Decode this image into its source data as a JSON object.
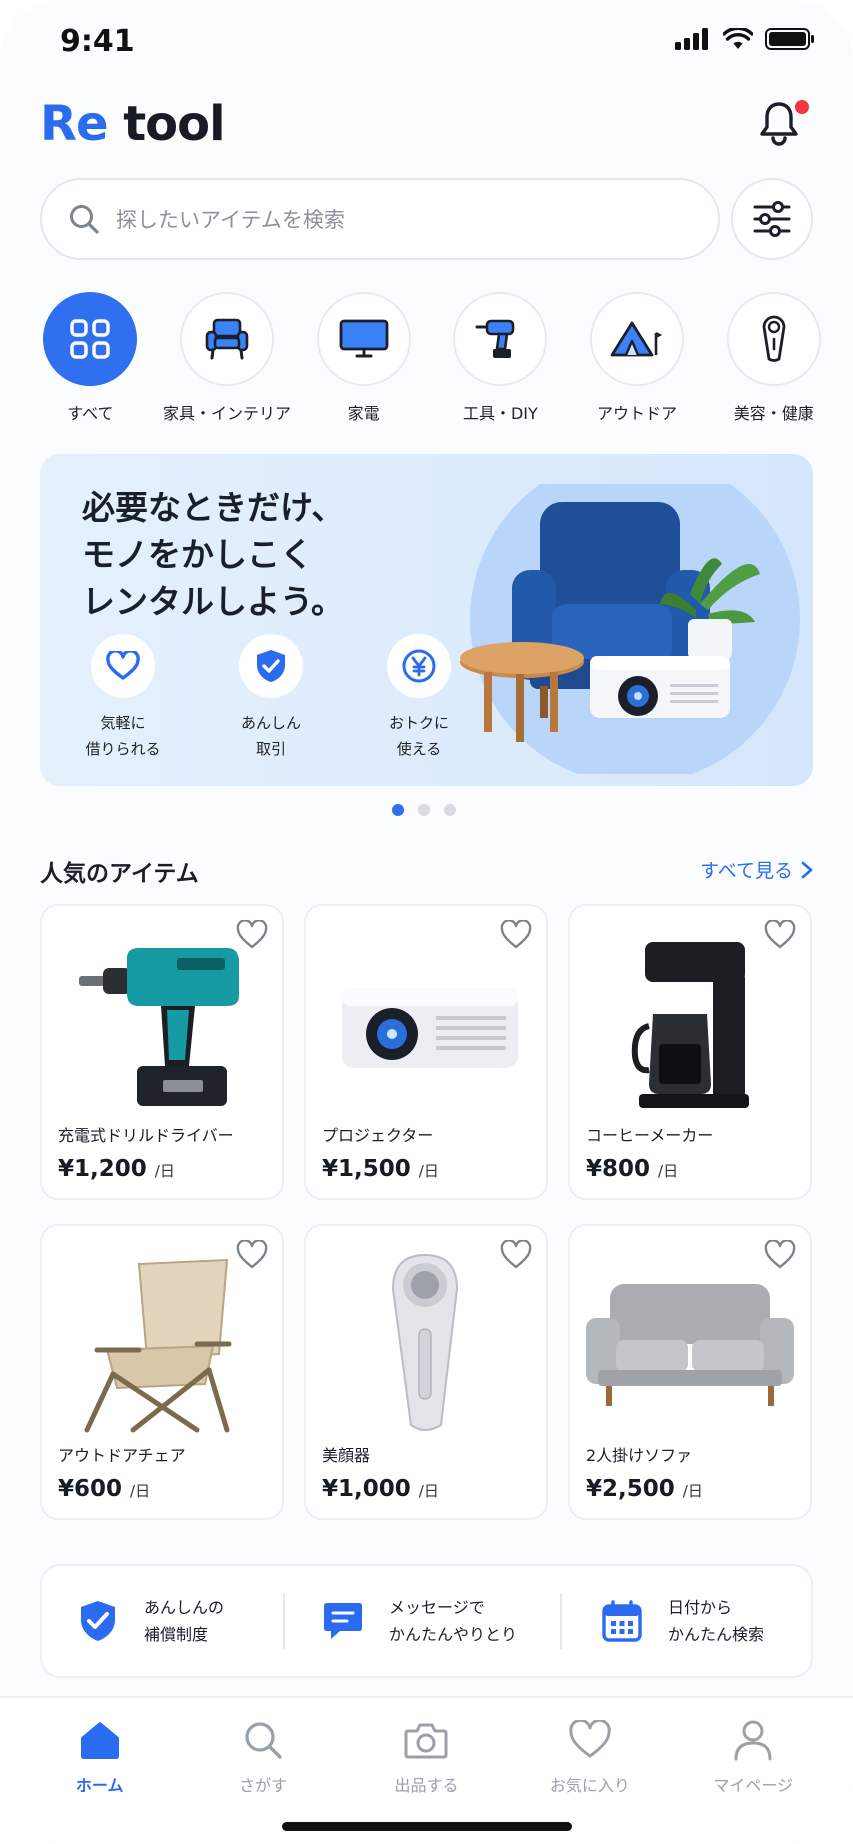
{
  "status_bar": {
    "time": "9:41"
  },
  "header": {
    "logo_re": "Re",
    "logo_tool": "tool"
  },
  "search": {
    "placeholder": "探したいアイテムを検索"
  },
  "categories": [
    {
      "label": "すべて",
      "icon": "grid-icon"
    },
    {
      "label": "家具・インテリア",
      "icon": "armchair-icon"
    },
    {
      "label": "家電",
      "icon": "monitor-icon"
    },
    {
      "label": "工具・DIY",
      "icon": "drill-icon"
    },
    {
      "label": "アウトドア",
      "icon": "tent-icon"
    },
    {
      "label": "美容・健康",
      "icon": "beauty-device-icon"
    }
  ],
  "banner": {
    "line1": "必要なときだけ、",
    "line2": "モノをかしこく",
    "line3": "レンタルしよう。",
    "features": [
      {
        "line1": "気軽に",
        "line2": "借りられる",
        "icon": "heart-icon"
      },
      {
        "line1": "あんしん",
        "line2": "取引",
        "icon": "shield-check-icon"
      },
      {
        "line1": "おトクに",
        "line2": "使える",
        "icon": "yen-icon"
      }
    ],
    "carousel_index": 1,
    "carousel_count": 3
  },
  "popular": {
    "title": "人気のアイテム",
    "see_all": "すべて見る",
    "items": [
      {
        "name": "充電式ドリルドライバー",
        "price": "¥1,200",
        "unit": "/日"
      },
      {
        "name": "プロジェクター",
        "price": "¥1,500",
        "unit": "/日"
      },
      {
        "name": "コーヒーメーカー",
        "price": "¥800",
        "unit": "/日"
      },
      {
        "name": "アウトドアチェア",
        "price": "¥600",
        "unit": "/日"
      },
      {
        "name": "美顔器",
        "price": "¥1,000",
        "unit": "/日"
      },
      {
        "name": "2人掛けソファ",
        "price": "¥2,500",
        "unit": "/日"
      }
    ]
  },
  "trust": [
    {
      "line1": "あんしんの",
      "line2": "補償制度",
      "icon": "shield-check-icon"
    },
    {
      "line1": "メッセージで",
      "line2": "かんたんやりとり",
      "icon": "message-icon"
    },
    {
      "line1": "日付から",
      "line2": "かんたん検索",
      "icon": "calendar-icon"
    }
  ],
  "nav": [
    {
      "label": "ホーム",
      "icon": "home-icon",
      "active": true
    },
    {
      "label": "さがす",
      "icon": "search-icon"
    },
    {
      "label": "出品する",
      "icon": "camera-icon"
    },
    {
      "label": "お気に入り",
      "icon": "heart-icon"
    },
    {
      "label": "マイページ",
      "icon": "user-icon"
    }
  ],
  "colors": {
    "accent": "#2a6bef",
    "notification": "#f2353f"
  }
}
